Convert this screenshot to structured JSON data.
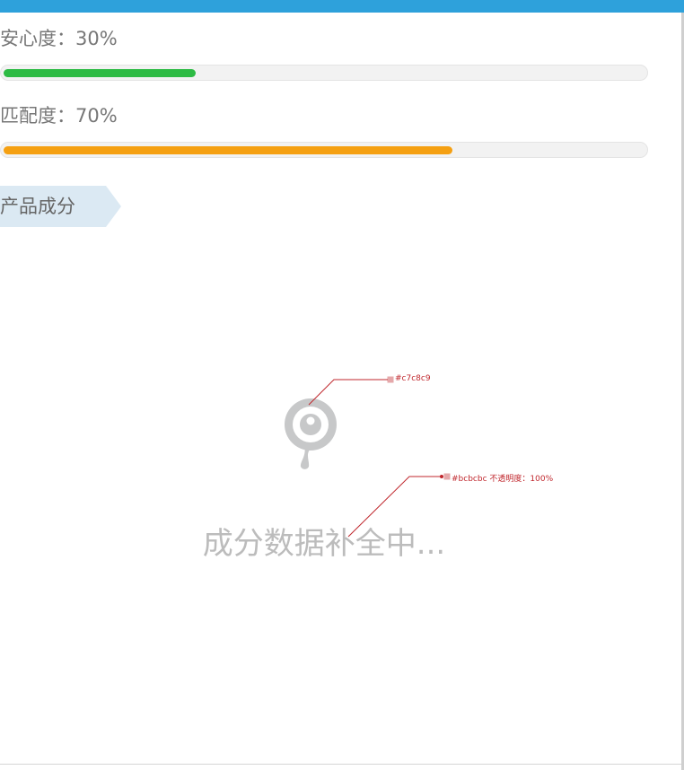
{
  "colors": {
    "header_bar": "#2ea1db",
    "safety_fill": "#2dbb44",
    "match_fill": "#f5a012",
    "track": "#f2f2f2",
    "tag_bg": "#dbe9f3",
    "placeholder_icon": "#c7c8c9",
    "placeholder_text": "#bcbcbc",
    "annotation": "#c0272d"
  },
  "metrics": [
    {
      "label": "安心度：30%",
      "value": 30
    },
    {
      "label": "匹配度：70%",
      "value": 70
    }
  ],
  "section": {
    "title": "产品成分"
  },
  "empty_state": {
    "icon": "eye-drop-icon",
    "message": "成分数据补全中..."
  },
  "annotations": [
    {
      "text": "#c7c8c9"
    },
    {
      "text": "#bcbcbc 不透明度：100%"
    }
  ]
}
